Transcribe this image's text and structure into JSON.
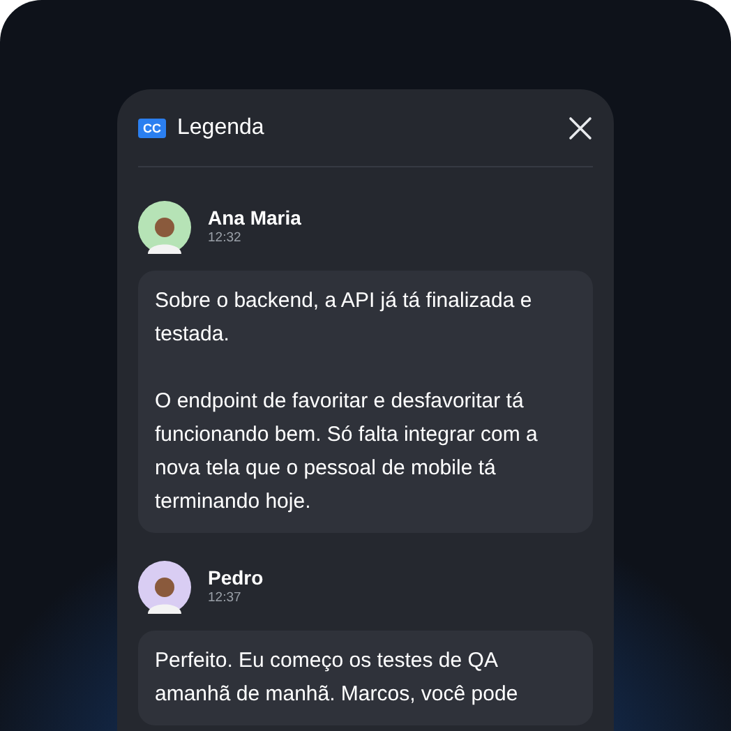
{
  "panel": {
    "title": "Legenda",
    "icon_text": "CC"
  },
  "messages": [
    {
      "author": "Ana Maria",
      "time": "12:32",
      "color": "#b6e3b6",
      "paragraphs": [
        "Sobre o backend, a API já tá finalizada e testada.",
        "O endpoint de favoritar e desfavoritar tá funcionando bem. Só falta integrar com a nova tela que o pessoal de mobile tá terminando hoje."
      ]
    },
    {
      "author": "Pedro",
      "time": "12:37",
      "color": "#d9cdf3",
      "paragraphs": [
        "Perfeito. Eu começo os testes de QA amanhã de manhã. Marcos, você pode"
      ]
    }
  ]
}
